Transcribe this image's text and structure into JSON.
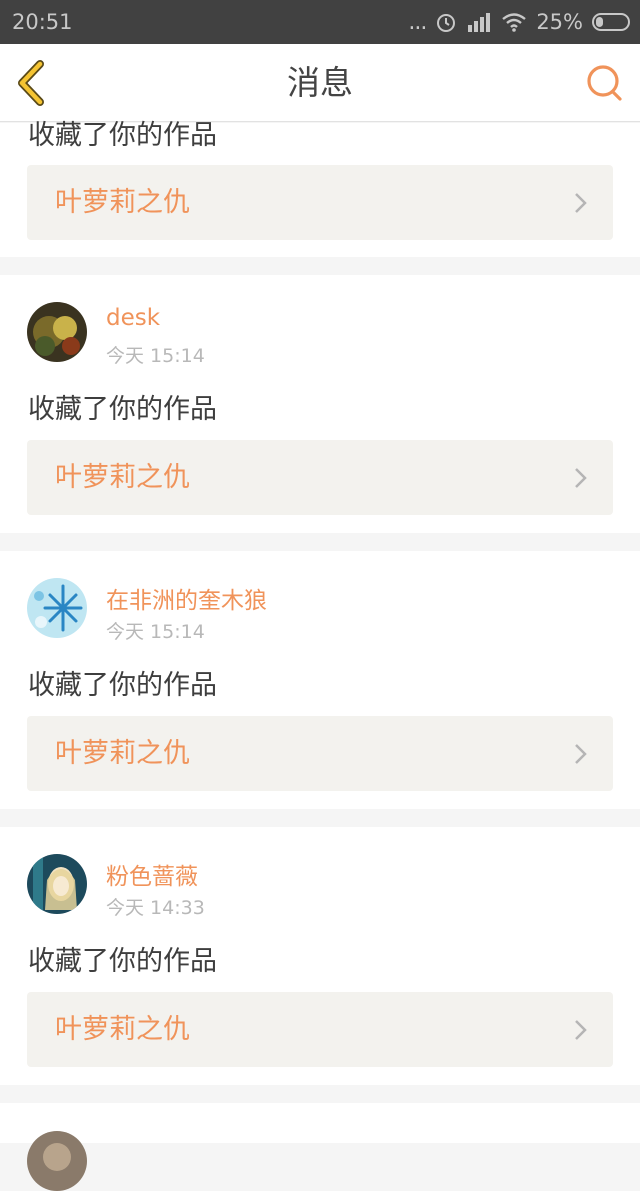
{
  "status_bar": {
    "time": "20:51",
    "dots": "...",
    "battery_percent": "25%",
    "icons": [
      "alarm-icon",
      "signal-icon",
      "wifi-icon",
      "battery-icon"
    ]
  },
  "nav": {
    "title": "消息",
    "back_icon": "chevron-left-icon",
    "search_icon": "search-icon"
  },
  "colors": {
    "accent": "#f0935a",
    "back_icon": "#f5c432",
    "work_box_bg": "#f3f2ee"
  },
  "notifications": [
    {
      "action": "收藏了你的作品",
      "work_title": "叶萝莉之仇"
    },
    {
      "username": "desk",
      "time": "今天 15:14",
      "action": "收藏了你的作品",
      "work_title": "叶萝莉之仇"
    },
    {
      "username": "在非洲的奎木狼",
      "time": "今天 15:14",
      "action": "收藏了你的作品",
      "work_title": "叶萝莉之仇"
    },
    {
      "username": "粉色蔷薇",
      "time": "今天 14:33",
      "action": "收藏了你的作品",
      "work_title": "叶萝莉之仇"
    }
  ]
}
